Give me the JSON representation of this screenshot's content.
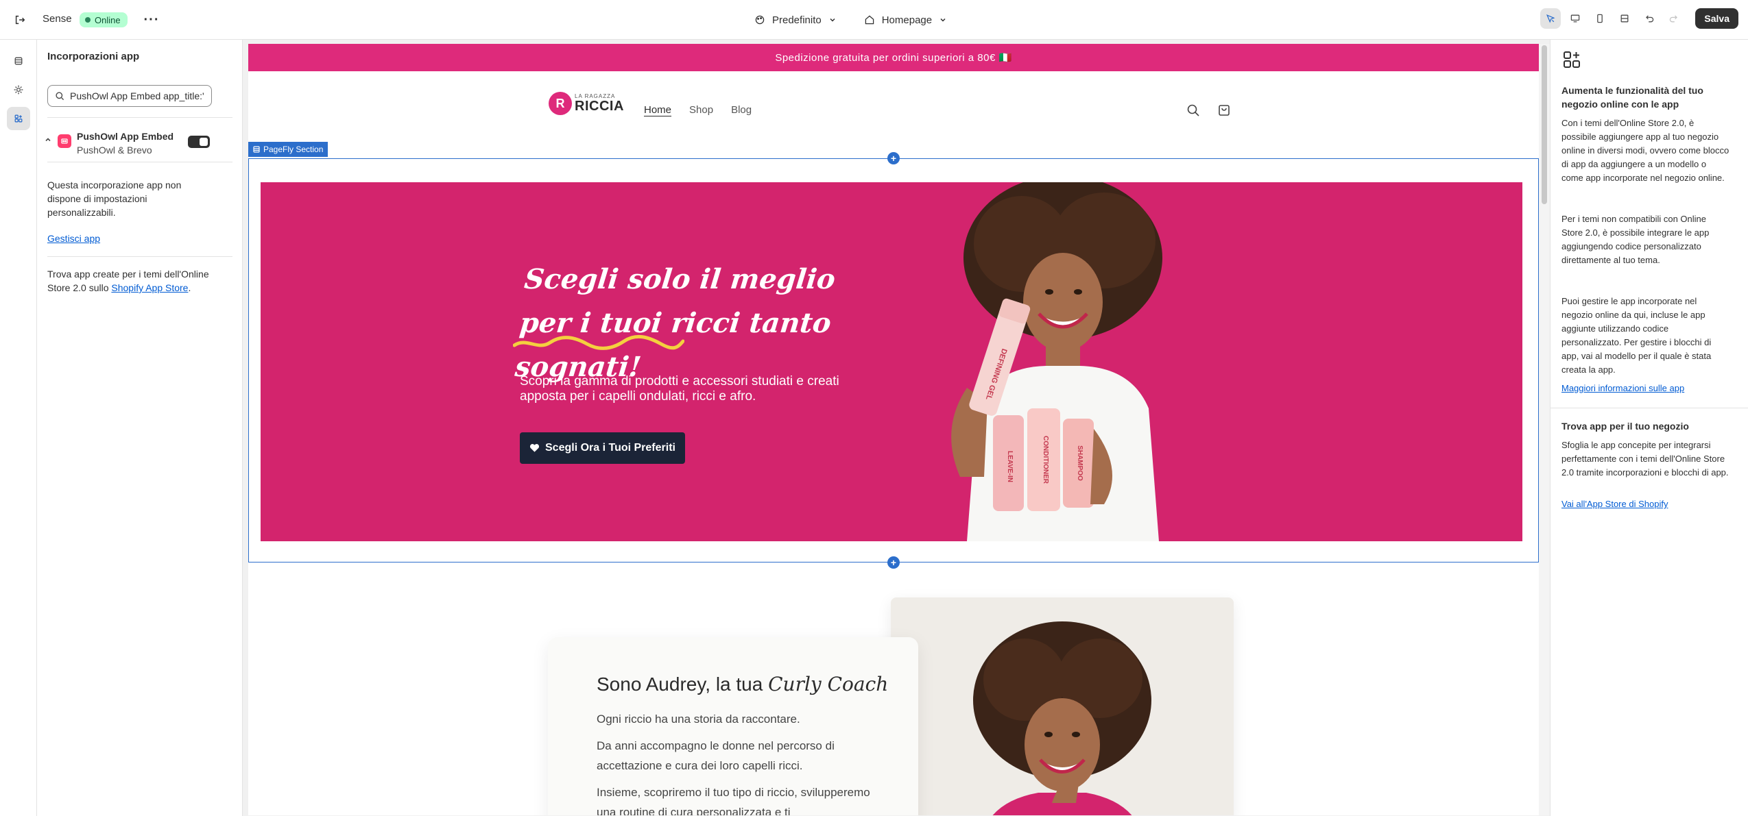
{
  "topbar": {
    "store_name": "Sense",
    "status": "Online",
    "theme_select": "Predefinito",
    "page_select": "Homepage",
    "save_label": "Salva"
  },
  "left_panel": {
    "title": "Incorporazioni app",
    "search_value": "PushOwl App Embed app_title:'",
    "app": {
      "name": "PushOwl App Embed",
      "vendor": "PushOwl & Brevo",
      "enabled": true
    },
    "no_settings_text": "Questa incorporazione app non dispone di impostazioni personalizzabili.",
    "manage_link": "Gestisci app",
    "footer_text": "Trova app create per i temi dell'Online Store 2.0 sullo",
    "footer_link": "Shopify App Store",
    "footer_end": "."
  },
  "preview": {
    "announcement": "Spedizione gratuita per ordini superiori a 80€ 🇮🇹",
    "logo_small": "LA RAGAZZA",
    "logo_big": "RICCIA",
    "nav": [
      "Home",
      "Shop",
      "Blog"
    ],
    "section_label": "PageFly Section",
    "hero": {
      "title": "Scegli solo il meglio per i tuoi ricci tanto sognati!",
      "subtitle": "Scopri la gamma di prodotti e accessori studiati e creati apposta per i capelli ondulati, ricci e afro.",
      "cta": "Scegli Ora i Tuoi Preferiti",
      "bottle_text": "DEFINING GEL",
      "product_1": "LEAVE-IN",
      "product_2": "CONDITIONER",
      "product_3": "SHAMPOO"
    },
    "coach": {
      "title_prefix": "Sono Audrey, la tua",
      "title_italic": "Curly Coach",
      "p1": "Ogni riccio ha una storia da raccontare.",
      "p2": "Da anni accompagno le donne nel percorso di accettazione e cura dei loro capelli ricci.",
      "p3": "Insieme, scopriremo il tuo tipo di riccio, svilupperemo una routine di cura personalizzata e ti"
    },
    "colors": {
      "brand_pink": "#de2a7b",
      "hero_pink": "#d3246d",
      "cta_navy": "#1b2437",
      "selection_blue": "#2c6ecb"
    }
  },
  "right_panel": {
    "heading1": "Aumenta le funzionalità del tuo negozio online con le app",
    "p1": "Con i temi dell'Online Store 2.0, è possibile aggiungere app al tuo negozio online in diversi modi, ovvero come blocco di app da aggiungere a un modello o come app incorporate nel negozio online.",
    "p2": "Per i temi non compatibili con Online Store 2.0, è possibile integrare le app aggiungendo codice personalizzato direttamente al tuo tema.",
    "p3": "Puoi gestire le app incorporate nel negozio online da qui, incluse le app aggiunte utilizzando codice personalizzato. Per gestire i blocchi di app, vai al modello per il quale è stata creata la app.",
    "link1": "Maggiori informazioni sulle app",
    "heading2": "Trova app per il tuo negozio",
    "p4": "Sfoglia le app concepite per integrarsi perfettamente con i temi dell'Online Store 2.0 tramite incorporazioni e blocchi di app.",
    "link2": "Vai all'App Store di Shopify"
  }
}
